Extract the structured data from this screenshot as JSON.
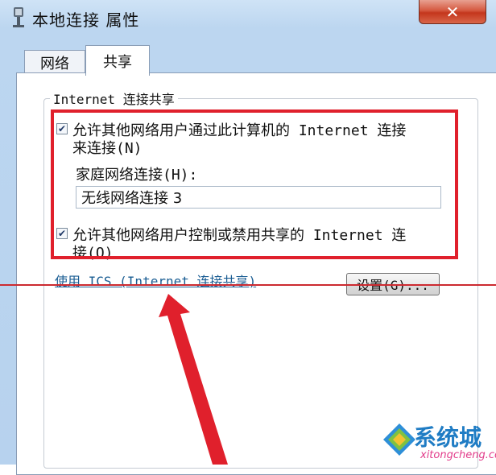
{
  "window": {
    "title": "本地连接 属性",
    "close_glyph": "✕"
  },
  "tabs": [
    {
      "label": "网络"
    },
    {
      "label": "共享"
    }
  ],
  "group": {
    "legend": "Internet 连接共享"
  },
  "option1": {
    "line1": "允许其他网络用户通过此计算机的 Internet 连接",
    "line2": "来连接(N)",
    "checked": true
  },
  "home_network": {
    "label": "家庭网络连接(H):",
    "value": "无线网络连接 3"
  },
  "option2": {
    "line1": "允许其他网络用户控制或禁用共享的 Internet 连",
    "line2": "接(O)",
    "checked": true
  },
  "ics_link": "使用 ICS (Internet 连接共享)",
  "settings_button": "设置(G)...",
  "watermark": {
    "brand": "系统城",
    "url": "xitongcheng.com"
  },
  "colors": {
    "highlight": "#e0202c",
    "link": "#1a5d93",
    "titlebar": "#bcd6f0"
  },
  "icons": {
    "title": "network-adapter-icon",
    "checkbox": "checkmark-icon",
    "watermark": "windows-logo-icon"
  }
}
